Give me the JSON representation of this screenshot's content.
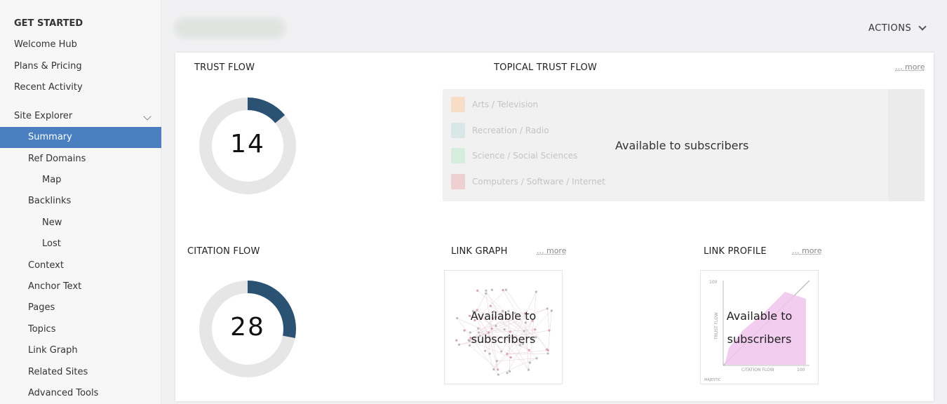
{
  "sidebar": {
    "section_title": "GET STARTED",
    "items": [
      {
        "label": "Welcome Hub"
      },
      {
        "label": "Plans & Pricing"
      },
      {
        "label": "Recent Activity"
      },
      {
        "label": "Site Explorer"
      },
      {
        "label": "Summary"
      },
      {
        "label": "Ref Domains"
      },
      {
        "label": "Map"
      },
      {
        "label": "Backlinks"
      },
      {
        "label": "New"
      },
      {
        "label": "Lost"
      },
      {
        "label": "Context"
      },
      {
        "label": "Anchor Text"
      },
      {
        "label": "Pages"
      },
      {
        "label": "Topics"
      },
      {
        "label": "Link Graph"
      },
      {
        "label": "Related Sites"
      },
      {
        "label": "Advanced Tools"
      }
    ],
    "active_item": "Summary"
  },
  "header": {
    "actions_label": "ACTIONS"
  },
  "trust_flow": {
    "title": "TRUST FLOW",
    "value": "14",
    "fraction": 0.14,
    "color": "#2b5272",
    "track_color": "#e6e6e6"
  },
  "citation_flow": {
    "title": "CITATION FLOW",
    "value": "28",
    "fraction": 0.28,
    "color": "#2b5272",
    "track_color": "#e6e6e6"
  },
  "topical_trust_flow": {
    "title": "TOPICAL TRUST FLOW",
    "more": "... more",
    "topics": [
      {
        "label": "Arts / Television",
        "color": "#f7dcc6"
      },
      {
        "label": "Recreation / Radio",
        "color": "#d9e7e6"
      },
      {
        "label": "Science / Social Sciences",
        "color": "#d6ecdc"
      },
      {
        "label": "Computers / Software / Internet",
        "color": "#efd0d2"
      }
    ],
    "message": "Available to subscribers"
  },
  "link_graph": {
    "title": "LINK GRAPH",
    "more": "... more",
    "message_line1": "Available to",
    "message_line2": "subscribers"
  },
  "link_profile": {
    "title": "LINK PROFILE",
    "more": "... more",
    "message_line1": "Available to",
    "message_line2": "subscribers",
    "axis_y": "TRUST FLOW",
    "axis_x": "CITATION FLOW",
    "tick_max_y": "100",
    "tick_max_x": "100",
    "brand": "MAJESTIC"
  },
  "colors": {
    "accent": "#4a7fc0",
    "flow_dark": "#2b5272"
  }
}
